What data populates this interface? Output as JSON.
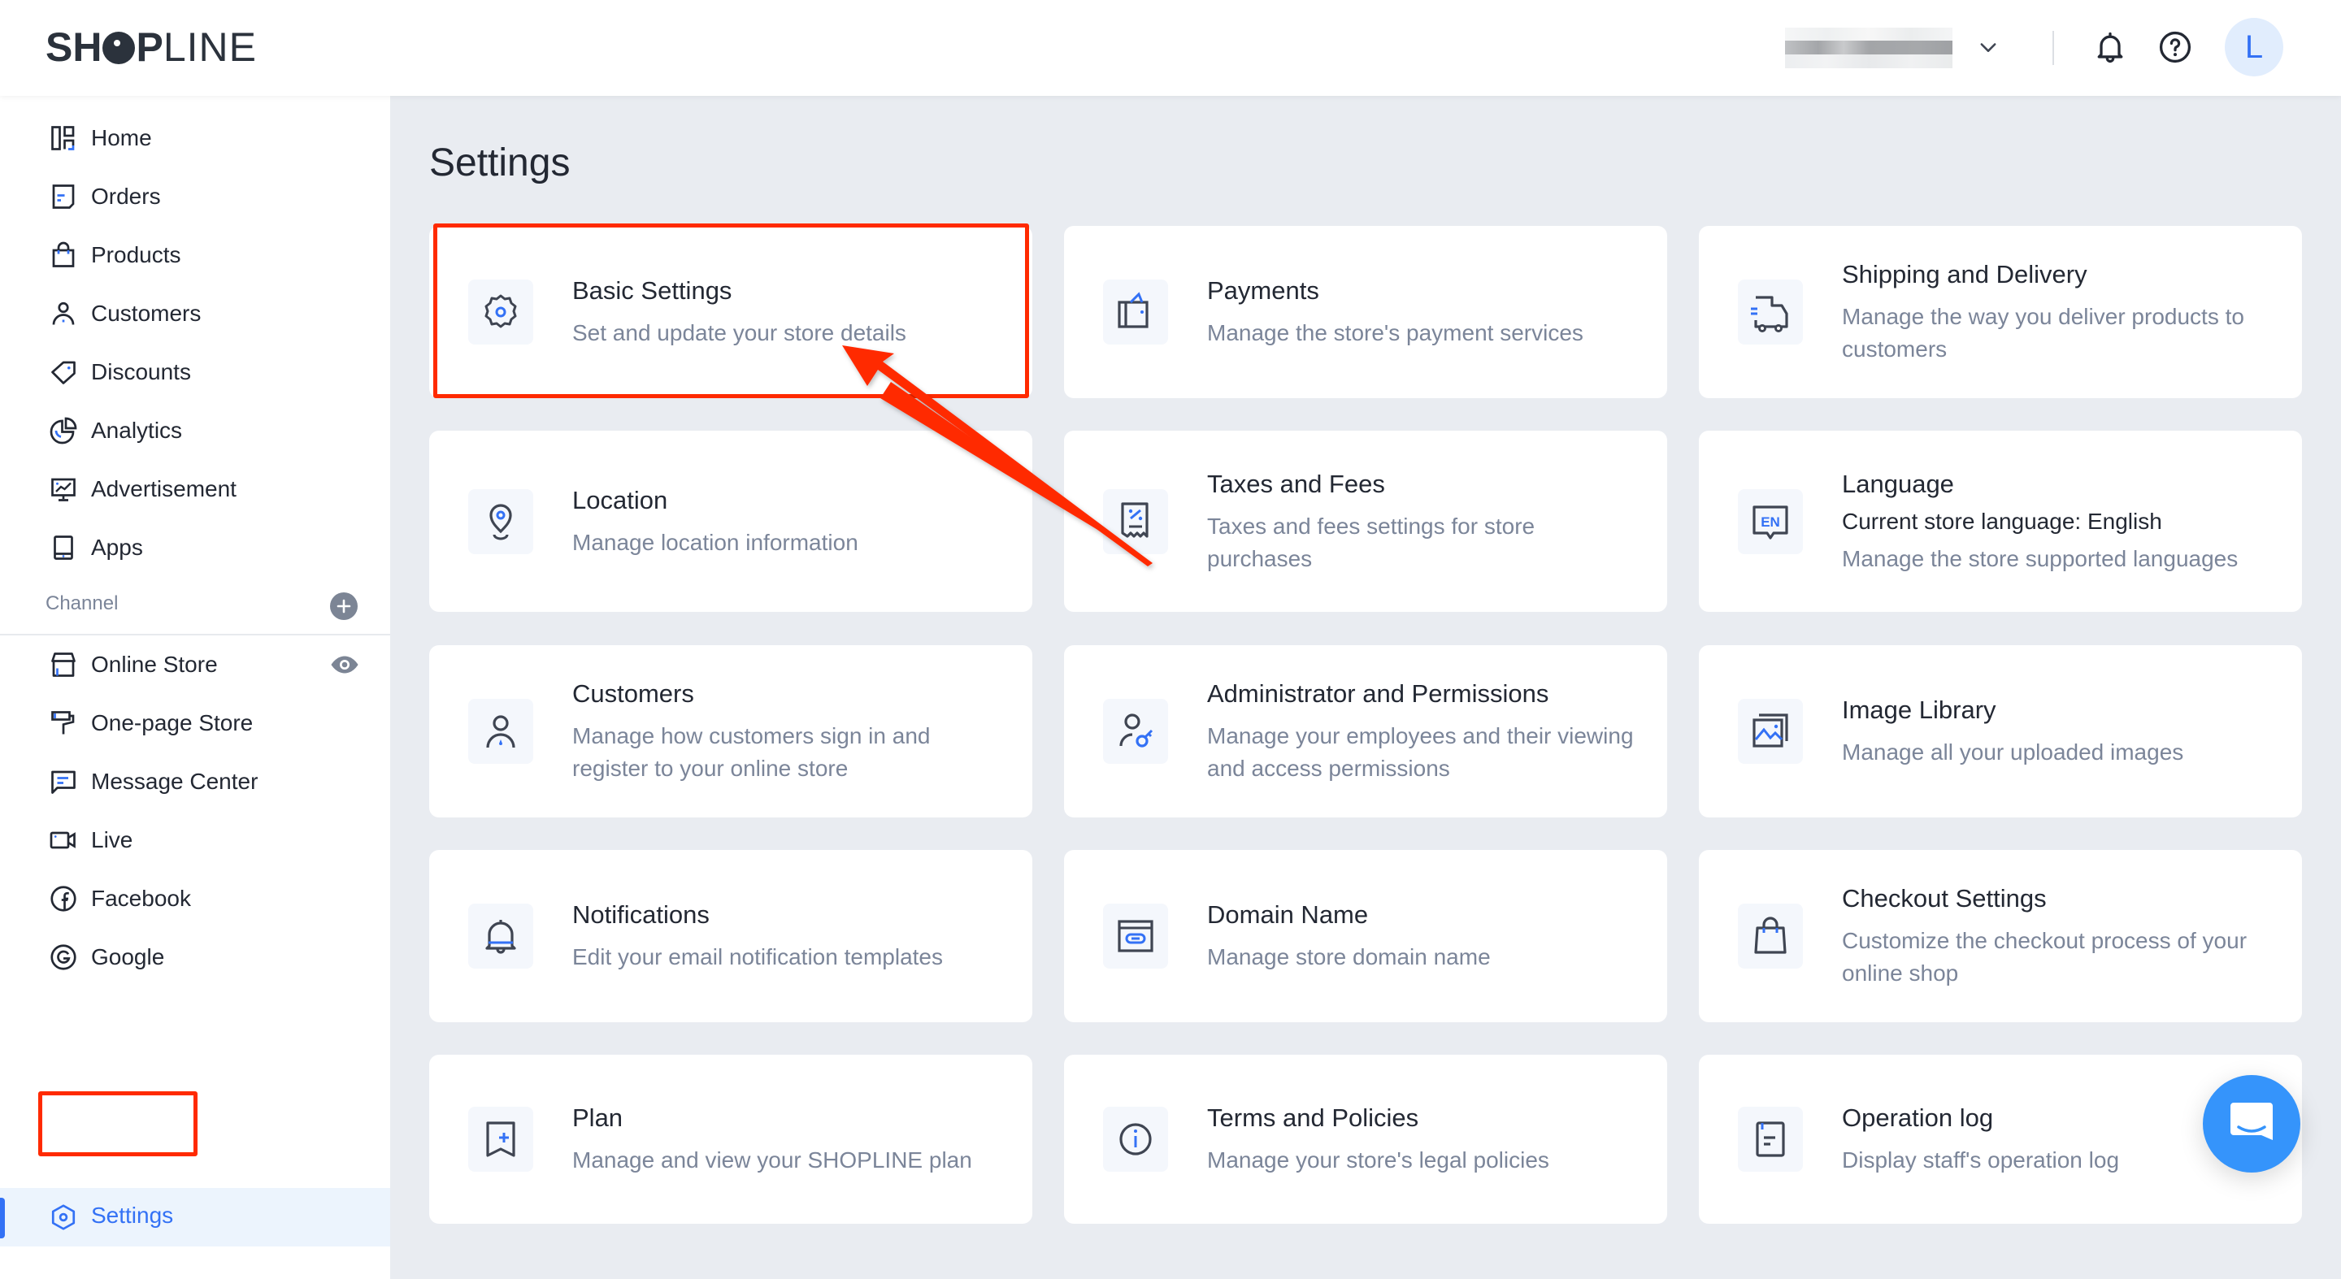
{
  "header": {
    "logo_bold": "SH",
    "logo_bold2": "P",
    "logo_thin": "LINE",
    "store_name": "[redacted store name]",
    "avatar_initial": "L"
  },
  "sidebar": {
    "items": [
      {
        "label": "Home",
        "icon": "home-dashboard-icon"
      },
      {
        "label": "Orders",
        "icon": "orders-icon"
      },
      {
        "label": "Products",
        "icon": "shopping-bag-icon"
      },
      {
        "label": "Customers",
        "icon": "person-icon"
      },
      {
        "label": "Discounts",
        "icon": "tag-icon"
      },
      {
        "label": "Analytics",
        "icon": "pie-chart-icon"
      },
      {
        "label": "Advertisement",
        "icon": "monitor-chart-icon"
      },
      {
        "label": "Apps",
        "icon": "tablet-icon"
      }
    ],
    "channel_label": "Channel",
    "channels": [
      {
        "label": "Online Store",
        "icon": "storefront-icon"
      },
      {
        "label": "One-page Store",
        "icon": "paint-roller-icon"
      },
      {
        "label": "Message Center",
        "icon": "chat-bubble-icon"
      },
      {
        "label": "Live",
        "icon": "video-camera-icon"
      },
      {
        "label": "Facebook",
        "icon": "facebook-icon"
      },
      {
        "label": "Google",
        "icon": "google-icon"
      }
    ],
    "active_item": {
      "label": "Settings",
      "icon": "hexagon-gear-icon"
    }
  },
  "main": {
    "title": "Settings",
    "cards": [
      {
        "title": "Basic Settings",
        "desc": "Set and update your store details",
        "icon": "gear-icon"
      },
      {
        "title": "Payments",
        "desc": "Manage the store's payment services",
        "icon": "wallet-icon"
      },
      {
        "title": "Shipping and Delivery",
        "desc": "Manage the way you deliver products to customers",
        "icon": "truck-icon"
      },
      {
        "title": "Location",
        "desc": "Manage location information",
        "icon": "location-pin-icon"
      },
      {
        "title": "Taxes and Fees",
        "desc": "Taxes and fees settings for store purchases",
        "icon": "receipt-percent-icon"
      },
      {
        "title": "Language",
        "extra": "Current store language: English",
        "desc": "Manage the store supported languages",
        "icon": "language-en-icon"
      },
      {
        "title": "Customers",
        "desc": "Manage how customers sign in and register to your online store",
        "icon": "person-icon"
      },
      {
        "title": "Administrator and Permissions",
        "desc": "Manage your employees and their viewing and access permissions",
        "icon": "user-key-icon"
      },
      {
        "title": "Image Library",
        "desc": "Manage all your uploaded images",
        "icon": "image-gallery-icon"
      },
      {
        "title": "Notifications",
        "desc": "Edit your email notification templates",
        "icon": "bell-icon"
      },
      {
        "title": "Domain Name",
        "desc": "Manage store domain name",
        "icon": "browser-link-icon"
      },
      {
        "title": "Checkout Settings",
        "desc": "Customize the checkout process of your online shop",
        "icon": "shopping-bag-icon"
      },
      {
        "title": "Plan",
        "desc": "Manage and view your SHOPLINE plan",
        "icon": "bookmark-plus-icon"
      },
      {
        "title": "Terms and Policies",
        "desc": "Manage your store's legal policies",
        "icon": "info-circle-icon"
      },
      {
        "title": "Operation log",
        "desc": "Display staff's operation log",
        "icon": "document-log-icon"
      }
    ]
  },
  "colors": {
    "accent": "#3371f5",
    "annotation_red": "#ff2a00",
    "chat_blue": "#3594fb",
    "page_bg": "#e9ecf1"
  }
}
